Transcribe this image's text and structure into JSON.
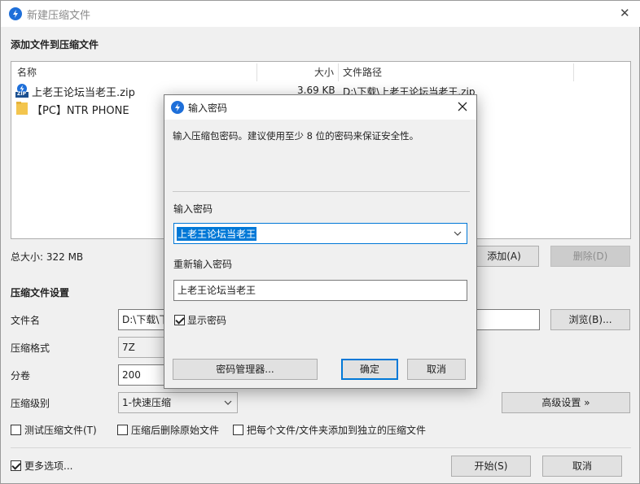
{
  "window": {
    "title": "新建压缩文件",
    "close_glyph": "✕"
  },
  "add_section": {
    "title": "添加文件到压缩文件"
  },
  "file_list": {
    "columns": [
      "名称",
      "大小",
      "文件路径"
    ],
    "rows": [
      {
        "name": "上老王论坛当老王.zip",
        "size": "3.69 KB",
        "path": "D:\\下载\\上老王论坛当老王.zip",
        "icon": "zip-file-icon"
      },
      {
        "name": "【PC】NTR PHONE",
        "size": "",
        "path": "",
        "icon": "folder-icon"
      }
    ],
    "zip_badge": "ZIP"
  },
  "total_size": "总大小: 322 MB",
  "buttons": {
    "add": "添加(A)",
    "delete": "删除(D)",
    "browse": "浏览(B)...",
    "advanced": "高级设置 »",
    "start": "开始(S)",
    "cancel": "取消"
  },
  "settings": {
    "title": "压缩文件设置",
    "filename_label": "文件名",
    "filename_value": "D:\\下载\\下",
    "format_label": "压缩格式",
    "format_value": "7Z",
    "split_label": "分卷",
    "split_value": "200",
    "level_label": "压缩级别",
    "level_value": "1-快速压缩"
  },
  "options": {
    "test": "测试压缩文件(T)",
    "delete_after": "压缩后删除原始文件",
    "separate": "把每个文件/文件夹添加到独立的压缩文件",
    "more": "更多选项..."
  },
  "password_dialog": {
    "title": "输入密码",
    "description": "输入压缩包密码。建议使用至少 8 位的密码来保证安全性。",
    "password_label": "输入密码",
    "password_value": "上老王论坛当老王",
    "reenter_label": "重新输入密码",
    "reenter_value": "上老王论坛当老王",
    "show_password": "显示密码",
    "manager_button": "密码管理器...",
    "ok_button": "确定",
    "cancel_button": "取消"
  },
  "colors": {
    "accent": "#1e6fd9",
    "selection": "#0078d7",
    "focus_border": "#0078d7",
    "folder": "#f3c54e"
  }
}
